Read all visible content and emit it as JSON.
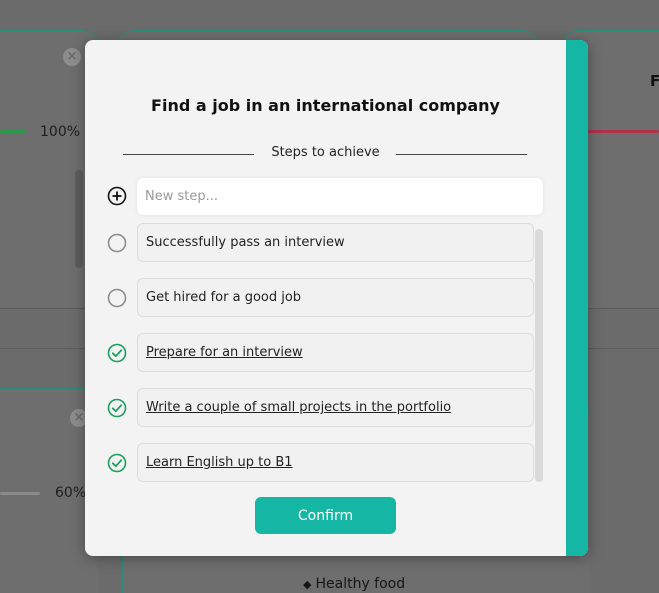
{
  "background": {
    "progress_cards": [
      {
        "percent_label": "100%",
        "progress": 1.0
      },
      {
        "percent_label": "60%",
        "progress": 0.6
      }
    ],
    "right_card_letter": "F",
    "healthy_food_item": "Healthy food"
  },
  "modal": {
    "title": "Find a job in an international company",
    "section_label": "Steps to achieve",
    "new_step_placeholder": "New step...",
    "new_step_value": "",
    "steps": [
      {
        "text": "Successfully pass an interview",
        "done": false
      },
      {
        "text": "Get hired for a good job",
        "done": false
      },
      {
        "text": "Prepare for an interview",
        "done": true
      },
      {
        "text": "Write a couple of small projects in the portfolio",
        "done": true
      },
      {
        "text": "Learn English up to B1",
        "done": true
      }
    ],
    "confirm_label": "Confirm"
  },
  "colors": {
    "accent": "#16b6a4",
    "done_check": "#1aa05a",
    "overlay": "#6b6b6b",
    "progress_green": "#2a9a4a",
    "progress_red": "#b0304a"
  },
  "icons": {
    "add": "plus-circle-icon",
    "step_pending": "empty-circle-icon",
    "step_done": "check-circle-icon",
    "background_close": "close-icon"
  }
}
